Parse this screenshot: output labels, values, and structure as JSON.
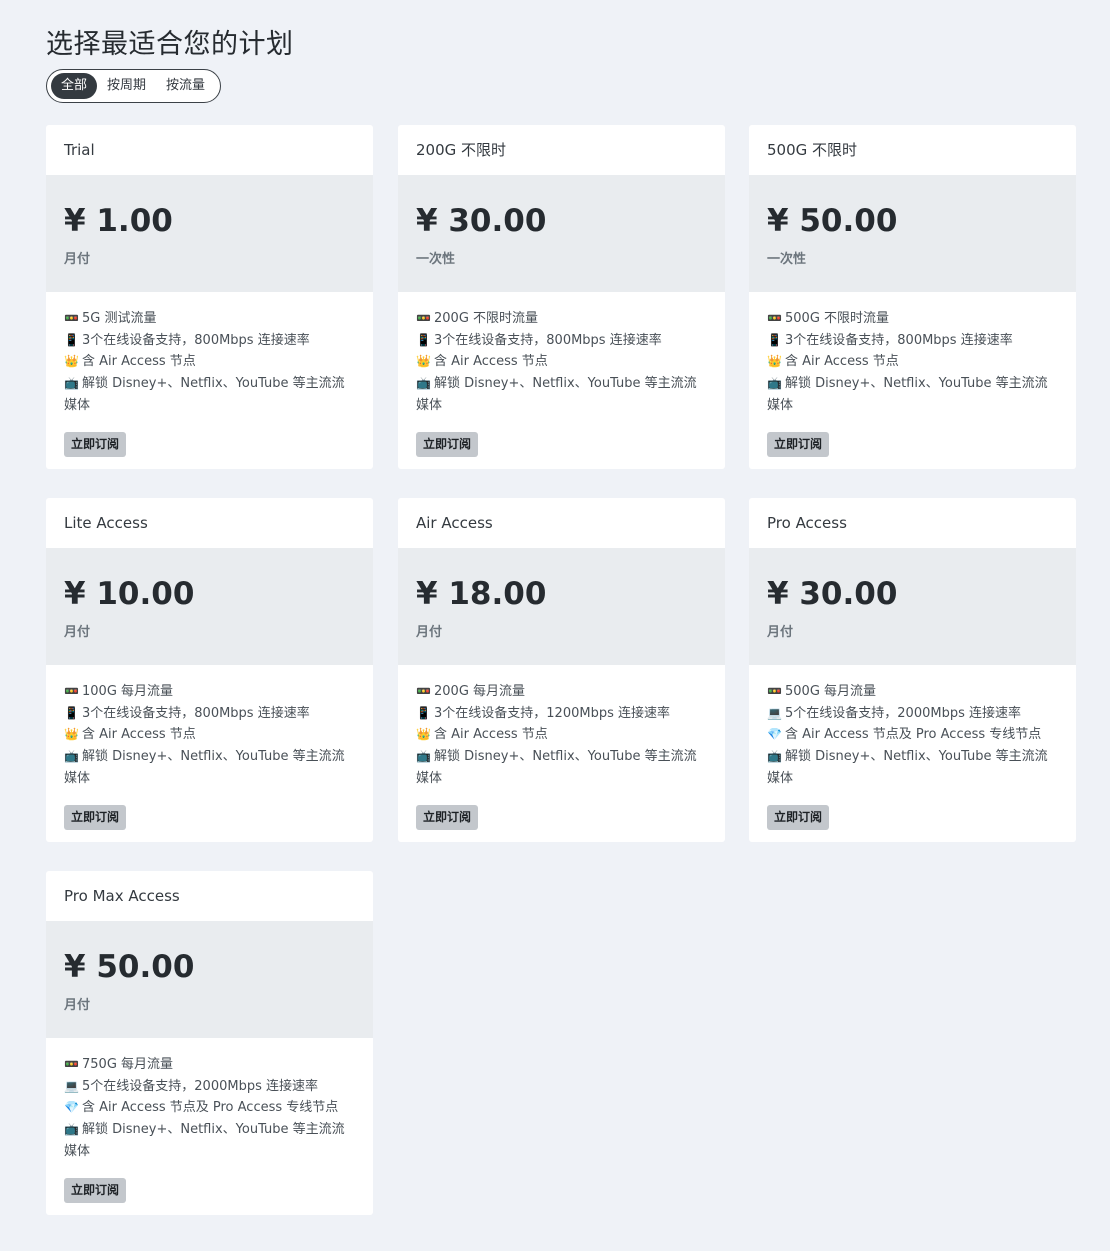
{
  "page": {
    "title": "选择最适合您的计划"
  },
  "filters": [
    {
      "label": "全部",
      "active": true
    },
    {
      "label": "按周期",
      "active": false
    },
    {
      "label": "按流量",
      "active": false
    }
  ],
  "plans": [
    {
      "name": "Trial",
      "price": "¥ 1.00",
      "period": "月付",
      "features": [
        {
          "icon": "🚥",
          "text": "5G 测试流量"
        },
        {
          "icon": "📱",
          "text": "3个在线设备支持，800Mbps 连接速率"
        },
        {
          "icon": "👑",
          "text": "含 Air Access 节点"
        },
        {
          "icon": "📺",
          "text": "解锁 Disney+、Netflix、YouTube 等主流流媒体"
        }
      ],
      "button": "立即订阅"
    },
    {
      "name": "200G 不限时",
      "price": "¥ 30.00",
      "period": "一次性",
      "features": [
        {
          "icon": "🚥",
          "text": "200G 不限时流量"
        },
        {
          "icon": "📱",
          "text": "3个在线设备支持，800Mbps 连接速率"
        },
        {
          "icon": "👑",
          "text": "含 Air Access 节点"
        },
        {
          "icon": "📺",
          "text": "解锁 Disney+、Netflix、YouTube 等主流流媒体"
        }
      ],
      "button": "立即订阅"
    },
    {
      "name": "500G 不限时",
      "price": "¥ 50.00",
      "period": "一次性",
      "features": [
        {
          "icon": "🚥",
          "text": "500G 不限时流量"
        },
        {
          "icon": "📱",
          "text": "3个在线设备支持，800Mbps 连接速率"
        },
        {
          "icon": "👑",
          "text": "含 Air Access 节点"
        },
        {
          "icon": "📺",
          "text": "解锁 Disney+、Netflix、YouTube 等主流流媒体"
        }
      ],
      "button": "立即订阅"
    },
    {
      "name": "Lite Access",
      "price": "¥ 10.00",
      "period": "月付",
      "features": [
        {
          "icon": "🚥",
          "text": "100G 每月流量"
        },
        {
          "icon": "📱",
          "text": "3个在线设备支持，800Mbps 连接速率"
        },
        {
          "icon": "👑",
          "text": "含 Air Access 节点"
        },
        {
          "icon": "📺",
          "text": "解锁 Disney+、Netflix、YouTube 等主流流媒体"
        }
      ],
      "button": "立即订阅"
    },
    {
      "name": "Air Access",
      "price": "¥ 18.00",
      "period": "月付",
      "features": [
        {
          "icon": "🚥",
          "text": "200G 每月流量"
        },
        {
          "icon": "📱",
          "text": "3个在线设备支持，1200Mbps 连接速率"
        },
        {
          "icon": "👑",
          "text": "含 Air Access 节点"
        },
        {
          "icon": "📺",
          "text": "解锁 Disney+、Netflix、YouTube 等主流流媒体"
        }
      ],
      "button": "立即订阅"
    },
    {
      "name": "Pro Access",
      "price": "¥ 30.00",
      "period": "月付",
      "features": [
        {
          "icon": "🚥",
          "text": "500G 每月流量"
        },
        {
          "icon": "💻",
          "text": "5个在线设备支持，2000Mbps 连接速率"
        },
        {
          "icon": "💎",
          "text": "含 Air Access 节点及 Pro Access 专线节点"
        },
        {
          "icon": "📺",
          "text": "解锁 Disney+、Netflix、YouTube 等主流流媒体"
        }
      ],
      "button": "立即订阅"
    },
    {
      "name": "Pro Max Access",
      "price": "¥ 50.00",
      "period": "月付",
      "features": [
        {
          "icon": "🚥",
          "text": "750G 每月流量"
        },
        {
          "icon": "💻",
          "text": "5个在线设备支持，2000Mbps 连接速率"
        },
        {
          "icon": "💎",
          "text": "含 Air Access 节点及 Pro Access 专线节点"
        },
        {
          "icon": "📺",
          "text": "解锁 Disney+、Netflix、YouTube 等主流流媒体"
        }
      ],
      "button": "立即订阅"
    }
  ]
}
